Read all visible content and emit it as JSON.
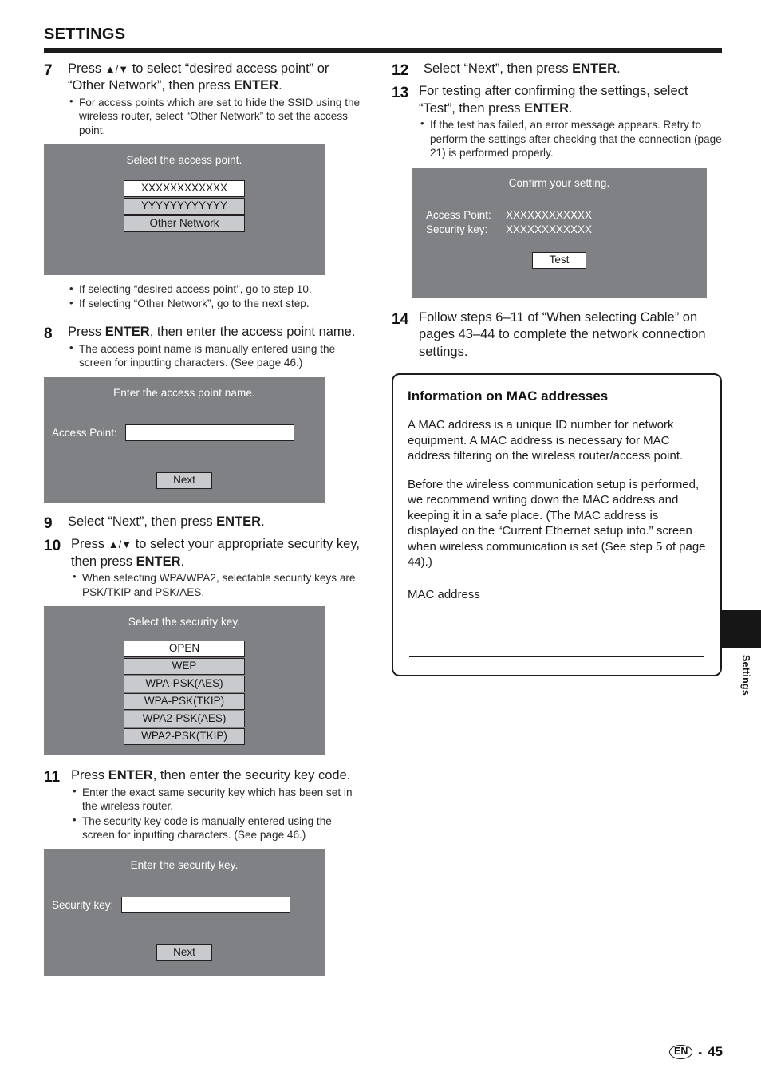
{
  "header": {
    "title": "SETTINGS"
  },
  "left_column": {
    "step7": {
      "num": "7",
      "text_1": "Press ",
      "arrows": "▲/▼",
      "text_2": " to select “desired access point” or “Other Network”, then press ",
      "bold": "ENTER",
      "text_3": ".",
      "bullets": [
        "For access points which are set to hide the SSID using the wireless router, select “Other Network” to set the access point."
      ]
    },
    "fig_access_point": {
      "title": "Select the access point.",
      "items": [
        {
          "label": "XXXXXXXXXXXX",
          "selected": true
        },
        {
          "label": "YYYYYYYYYYYY",
          "selected": false
        },
        {
          "label": "Other Network",
          "selected": false
        }
      ]
    },
    "notes_after_fig": [
      "If selecting “desired access point”, go to step 10.",
      "If selecting “Other Network”, go to the next step."
    ],
    "step8": {
      "num": "8",
      "text_1": "Press ",
      "bold": "ENTER",
      "text_2": ", then enter the access point name.",
      "bullets": [
        "The access point name is manually entered using the screen for inputting characters. (See page 46.)"
      ]
    },
    "fig_ap_name": {
      "title": "Enter the access point name.",
      "field_label": "Access Point:",
      "field_value": "",
      "button": "Next"
    },
    "step9": {
      "num": "9",
      "text_1": "Select “Next”, then press ",
      "bold": "ENTER",
      "text_2": "."
    },
    "step10": {
      "num": "10",
      "text_1": "Press ",
      "arrows": "▲/▼",
      "text_2": " to select your appropriate security key, then press ",
      "bold": "ENTER",
      "text_3": ".",
      "bullets": [
        "When selecting WPA/WPA2, selectable security keys are PSK/TKIP and PSK/AES."
      ]
    },
    "fig_security_key": {
      "title": "Select the security key.",
      "items": [
        {
          "label": "OPEN",
          "selected": true
        },
        {
          "label": "WEP",
          "selected": false
        },
        {
          "label": "WPA-PSK(AES)",
          "selected": false
        },
        {
          "label": "WPA-PSK(TKIP)",
          "selected": false
        },
        {
          "label": "WPA2-PSK(AES)",
          "selected": false
        },
        {
          "label": "WPA2-PSK(TKIP)",
          "selected": false
        }
      ]
    },
    "step11": {
      "num": "11",
      "text_1": "Press ",
      "bold": "ENTER",
      "text_2": ", then enter the security key code.",
      "bullets": [
        "Enter the exact same security key which has been set in the wireless router.",
        "The security key code is manually entered using the screen for inputting characters. (See page 46.)"
      ]
    },
    "fig_enter_security_key": {
      "title": "Enter the security key.",
      "field_label": "Security key:",
      "field_value": "",
      "button": "Next"
    }
  },
  "right_column": {
    "step12": {
      "num": "12",
      "text_1": "Select “Next”, then press ",
      "bold": "ENTER",
      "text_2": "."
    },
    "step13": {
      "num": "13",
      "text_1": "For testing after confirming the settings, select “Test”, then press ",
      "bold": "ENTER",
      "text_2": ".",
      "bullets": [
        "If the test has failed, an error message appears. Retry to perform the settings after checking that the connection (page 21) is performed properly."
      ]
    },
    "fig_confirm": {
      "title": "Confirm your setting.",
      "rows": [
        {
          "key": "Access Point:",
          "value": "XXXXXXXXXXXX"
        },
        {
          "key": "Security key:",
          "value": "XXXXXXXXXXXX"
        }
      ],
      "button": "Test"
    },
    "step14": {
      "num": "14",
      "text": "Follow steps 6–11 of “When selecting Cable” on pages 43–44 to complete the network connection settings."
    },
    "mac_box": {
      "title": "Information on MAC addresses",
      "paragraph_1": "A MAC address is a unique ID number for network equipment. A MAC address is necessary for MAC address filtering on the wireless router/access point.",
      "paragraph_2": "Before the wireless communication setup is performed, we recommend writing down the MAC address and keeping it in a safe place. (The MAC address is displayed on the “Current Ethernet setup info.” screen when wireless communication is set (See step 5 of page 44).)",
      "field_label": "MAC address"
    }
  },
  "side_tab": {
    "label": "Settings"
  },
  "footer": {
    "language": "EN",
    "separator": "-",
    "page_number": "45"
  },
  "colors": {
    "osd_background": "#808185",
    "osd_item": "#c9cace",
    "osd_item_selected": "#ffffff",
    "rule": "#1b1b1b"
  }
}
